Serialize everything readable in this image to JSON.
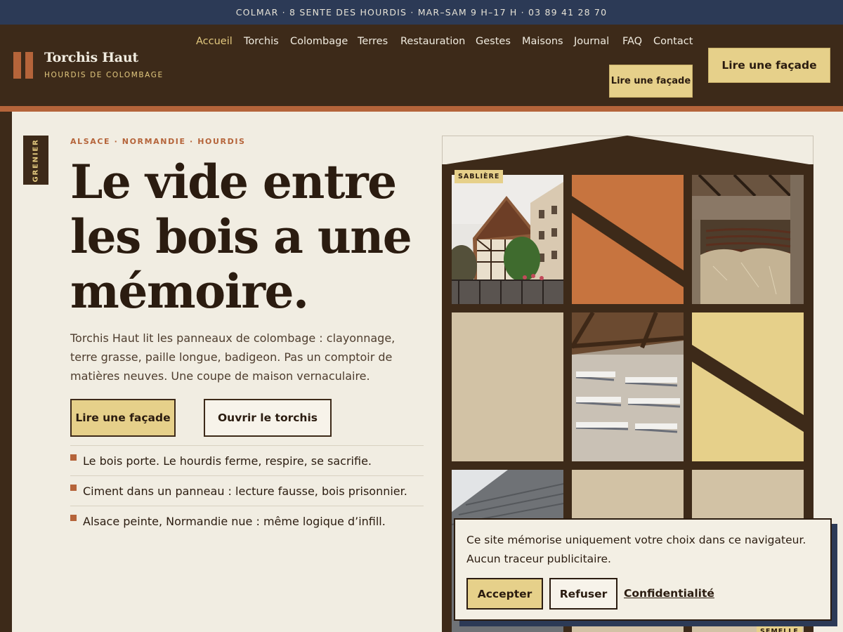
{
  "topbar": {
    "text": "COLMAR · 8 SENTE DES HOURDIS · MAR–SAM 9 H–17 H · 03 89 41 28 70"
  },
  "brand": {
    "name": "Torchis Haut",
    "tagline": "HOURDIS DE COLOMBAGE"
  },
  "nav": {
    "items": [
      {
        "label": "Accueil",
        "active": true
      },
      {
        "label": "Torchis"
      },
      {
        "label": "Colombage"
      },
      {
        "label": "Terres"
      },
      {
        "label": "Restauration"
      },
      {
        "label": "Gestes"
      },
      {
        "label": "Maisons"
      },
      {
        "label": "Journal"
      },
      {
        "label": "FAQ"
      },
      {
        "label": "Contact"
      }
    ],
    "cta_small": "Lire une façade",
    "cta_big": "Lire une façade"
  },
  "side_tag": "GRENIER",
  "hero": {
    "eyebrow": "ALSACE · NORMANDIE · HOURDIS",
    "title_lines": [
      "Le vide entre",
      "les bois a une",
      "mémoire."
    ],
    "lede": "Torchis Haut lit les panneaux de colombage : clayonnage, terre grasse, paille longue, badigeon. Pas un comptoir de matières neuves. Une coupe de maison vernaculaire.",
    "cta_primary": "Lire une façade",
    "cta_secondary": "Ouvrir le torchis",
    "bullets": [
      "Le bois porte. Le hourdis ferme, respire, se sacrifie.",
      "Ciment dans un panneau : lecture fausse, bois prisonnier.",
      "Alsace peinte, Normandie nue : même logique d’infill."
    ]
  },
  "house": {
    "tag_top": "SABLIÈRE",
    "tag_bottom": "SEMELLE",
    "colors": {
      "ochre_red": "#c7743f",
      "straw": "#e6d08a",
      "clay": "#d2c2a5",
      "timber": "#3d2a19"
    }
  },
  "cookie": {
    "text": "Ce site mémorise uniquement votre choix dans ce navigateur. Aucun traceur publicitaire.",
    "accept": "Accepter",
    "refuse": "Refuser",
    "privacy": "Confidentialité"
  }
}
